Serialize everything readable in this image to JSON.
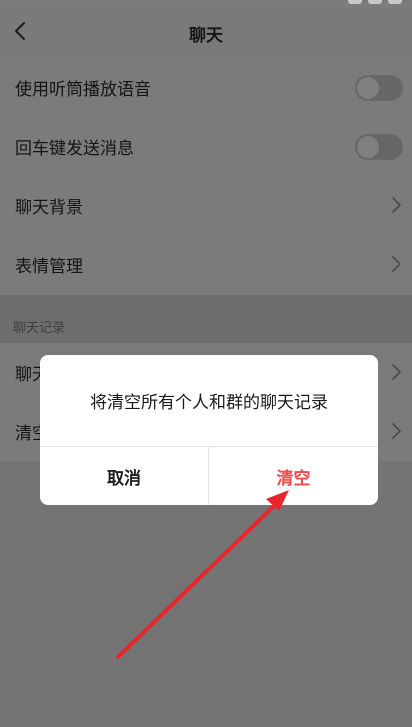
{
  "nav": {
    "title": "聊天"
  },
  "settings": [
    {
      "label": "使用听筒播放语音",
      "control": "toggle",
      "on": false
    },
    {
      "label": "回车键发送消息",
      "control": "toggle",
      "on": false
    },
    {
      "label": "聊天背景",
      "control": "chevron"
    },
    {
      "label": "表情管理",
      "control": "chevron"
    }
  ],
  "section": {
    "title": "聊天记录"
  },
  "records": [
    {
      "label": "聊天"
    },
    {
      "label": "清空"
    }
  ],
  "dialog": {
    "message": "将清空所有个人和群的聊天记录",
    "cancel_label": "取消",
    "confirm_label": "清空",
    "confirm_color": "#f24a4a"
  },
  "annotation": {
    "arrow_color": "#e8262b"
  }
}
